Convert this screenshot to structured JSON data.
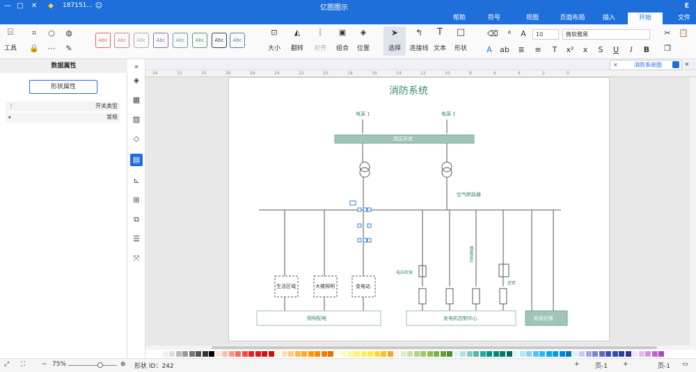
{
  "app": {
    "title": "亿图图示"
  },
  "titlebar": {
    "user_id": "187151...",
    "icons": [
      "app-logo-icon",
      "minimize-icon",
      "maximize-icon",
      "close-icon",
      "gem-icon",
      "user-icon"
    ]
  },
  "tabs": [
    {
      "label": "文件"
    },
    {
      "label": "开始",
      "active": true
    },
    {
      "label": "插入"
    },
    {
      "label": "页面布局"
    },
    {
      "label": "视图"
    },
    {
      "label": "符号"
    },
    {
      "label": "帮助"
    }
  ],
  "ribbon": {
    "font_name": "微软雅黑",
    "font_size": "10",
    "tools": {
      "select": "选择",
      "connector": "连接线",
      "text": "文本",
      "shape": "形状"
    },
    "arrange": {
      "position": "位置",
      "group": "组合",
      "align": "对齐",
      "rotate": "翻转",
      "size": "大小"
    },
    "style_label": "Abc",
    "tools_label": "工具"
  },
  "left_panel": {
    "title": "数据属性",
    "button": "形状属性",
    "rows": [
      {
        "label": "开关类型"
      },
      {
        "label": "常规"
      }
    ]
  },
  "doc_tab": {
    "label": "消防系统图"
  },
  "ruler_ticks": [
    "34",
    "32",
    "30",
    "28",
    "26",
    "24",
    "22",
    "20",
    "18",
    "16",
    "14",
    "12",
    "10",
    "8",
    "6",
    "4",
    "2",
    "0"
  ],
  "diagram": {
    "title": "消防系统",
    "source1": "电源 1",
    "source2": "电源 1",
    "switchgear": "高压开关",
    "breaker": "空气断路器",
    "labels": {
      "b1": "生活区域",
      "b2": "大楼照明",
      "b3": "变电站",
      "bar1": "照明配电",
      "bar2": "发电机控制中心",
      "bar3": "机组切换",
      "vlabel1": "电压检测",
      "vlabel2": "隔离变压",
      "vlabel3": "逆变"
    }
  },
  "status": {
    "page": "页-1",
    "page_tab": "页-1",
    "shape_id": "形状 ID：242",
    "zoom": "75%"
  },
  "colors": {
    "accent": "#1e6fd9",
    "switchgear": "#9fc4b8",
    "diagram_text": "#3a8a6a"
  }
}
